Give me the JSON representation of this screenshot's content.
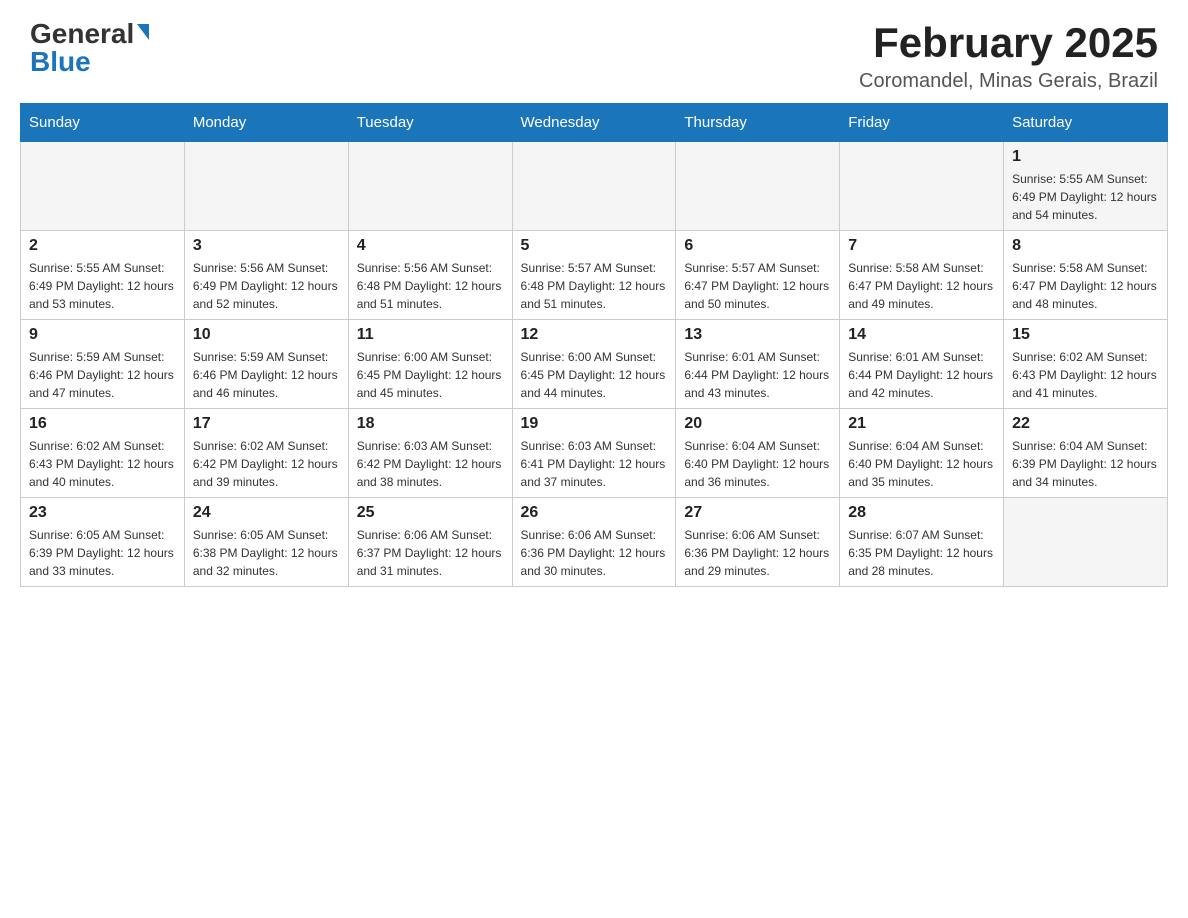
{
  "logo": {
    "general": "General",
    "blue": "Blue"
  },
  "title": "February 2025",
  "subtitle": "Coromandel, Minas Gerais, Brazil",
  "days_of_week": [
    "Sunday",
    "Monday",
    "Tuesday",
    "Wednesday",
    "Thursday",
    "Friday",
    "Saturday"
  ],
  "weeks": [
    [
      {
        "day": "",
        "info": ""
      },
      {
        "day": "",
        "info": ""
      },
      {
        "day": "",
        "info": ""
      },
      {
        "day": "",
        "info": ""
      },
      {
        "day": "",
        "info": ""
      },
      {
        "day": "",
        "info": ""
      },
      {
        "day": "1",
        "info": "Sunrise: 5:55 AM\nSunset: 6:49 PM\nDaylight: 12 hours and 54 minutes."
      }
    ],
    [
      {
        "day": "2",
        "info": "Sunrise: 5:55 AM\nSunset: 6:49 PM\nDaylight: 12 hours and 53 minutes."
      },
      {
        "day": "3",
        "info": "Sunrise: 5:56 AM\nSunset: 6:49 PM\nDaylight: 12 hours and 52 minutes."
      },
      {
        "day": "4",
        "info": "Sunrise: 5:56 AM\nSunset: 6:48 PM\nDaylight: 12 hours and 51 minutes."
      },
      {
        "day": "5",
        "info": "Sunrise: 5:57 AM\nSunset: 6:48 PM\nDaylight: 12 hours and 51 minutes."
      },
      {
        "day": "6",
        "info": "Sunrise: 5:57 AM\nSunset: 6:47 PM\nDaylight: 12 hours and 50 minutes."
      },
      {
        "day": "7",
        "info": "Sunrise: 5:58 AM\nSunset: 6:47 PM\nDaylight: 12 hours and 49 minutes."
      },
      {
        "day": "8",
        "info": "Sunrise: 5:58 AM\nSunset: 6:47 PM\nDaylight: 12 hours and 48 minutes."
      }
    ],
    [
      {
        "day": "9",
        "info": "Sunrise: 5:59 AM\nSunset: 6:46 PM\nDaylight: 12 hours and 47 minutes."
      },
      {
        "day": "10",
        "info": "Sunrise: 5:59 AM\nSunset: 6:46 PM\nDaylight: 12 hours and 46 minutes."
      },
      {
        "day": "11",
        "info": "Sunrise: 6:00 AM\nSunset: 6:45 PM\nDaylight: 12 hours and 45 minutes."
      },
      {
        "day": "12",
        "info": "Sunrise: 6:00 AM\nSunset: 6:45 PM\nDaylight: 12 hours and 44 minutes."
      },
      {
        "day": "13",
        "info": "Sunrise: 6:01 AM\nSunset: 6:44 PM\nDaylight: 12 hours and 43 minutes."
      },
      {
        "day": "14",
        "info": "Sunrise: 6:01 AM\nSunset: 6:44 PM\nDaylight: 12 hours and 42 minutes."
      },
      {
        "day": "15",
        "info": "Sunrise: 6:02 AM\nSunset: 6:43 PM\nDaylight: 12 hours and 41 minutes."
      }
    ],
    [
      {
        "day": "16",
        "info": "Sunrise: 6:02 AM\nSunset: 6:43 PM\nDaylight: 12 hours and 40 minutes."
      },
      {
        "day": "17",
        "info": "Sunrise: 6:02 AM\nSunset: 6:42 PM\nDaylight: 12 hours and 39 minutes."
      },
      {
        "day": "18",
        "info": "Sunrise: 6:03 AM\nSunset: 6:42 PM\nDaylight: 12 hours and 38 minutes."
      },
      {
        "day": "19",
        "info": "Sunrise: 6:03 AM\nSunset: 6:41 PM\nDaylight: 12 hours and 37 minutes."
      },
      {
        "day": "20",
        "info": "Sunrise: 6:04 AM\nSunset: 6:40 PM\nDaylight: 12 hours and 36 minutes."
      },
      {
        "day": "21",
        "info": "Sunrise: 6:04 AM\nSunset: 6:40 PM\nDaylight: 12 hours and 35 minutes."
      },
      {
        "day": "22",
        "info": "Sunrise: 6:04 AM\nSunset: 6:39 PM\nDaylight: 12 hours and 34 minutes."
      }
    ],
    [
      {
        "day": "23",
        "info": "Sunrise: 6:05 AM\nSunset: 6:39 PM\nDaylight: 12 hours and 33 minutes."
      },
      {
        "day": "24",
        "info": "Sunrise: 6:05 AM\nSunset: 6:38 PM\nDaylight: 12 hours and 32 minutes."
      },
      {
        "day": "25",
        "info": "Sunrise: 6:06 AM\nSunset: 6:37 PM\nDaylight: 12 hours and 31 minutes."
      },
      {
        "day": "26",
        "info": "Sunrise: 6:06 AM\nSunset: 6:36 PM\nDaylight: 12 hours and 30 minutes."
      },
      {
        "day": "27",
        "info": "Sunrise: 6:06 AM\nSunset: 6:36 PM\nDaylight: 12 hours and 29 minutes."
      },
      {
        "day": "28",
        "info": "Sunrise: 6:07 AM\nSunset: 6:35 PM\nDaylight: 12 hours and 28 minutes."
      },
      {
        "day": "",
        "info": ""
      }
    ]
  ]
}
